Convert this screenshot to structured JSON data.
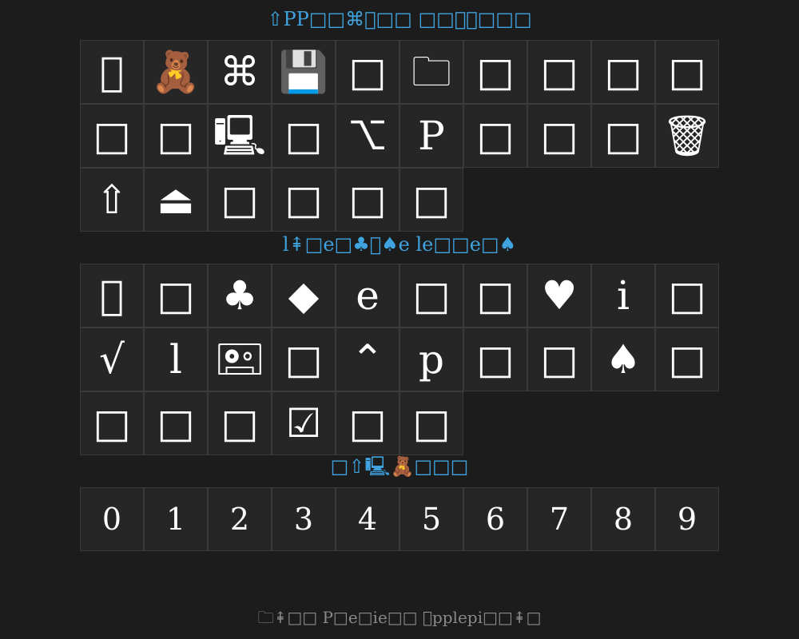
{
  "section1": {
    "heading": "⇧PP□□⌘□□ □□🗑🗑□□□",
    "glyphs": [
      "",
      "🧸",
      "⌘",
      "💾",
      "□",
      "🗀",
      "□",
      "□",
      "□",
      "□",
      "□",
      "□",
      "🖳",
      "□",
      "⌥",
      "P",
      "□",
      "□",
      "□",
      "🗑",
      "⇧",
      "⏏",
      "□",
      "□",
      "□",
      "□"
    ]
  },
  "section2": {
    "heading": "l⇞□e□♣♠e le□□e□♠",
    "glyphs": [
      "",
      "□",
      "♣",
      "◆",
      "e",
      "□",
      "□",
      "♥",
      "i",
      "□",
      "√",
      "l",
      "🖭",
      "□",
      "⌃",
      "p",
      "□",
      "□",
      "♠",
      "□",
      "□",
      "□",
      "□",
      "☑",
      "□",
      "□"
    ]
  },
  "section3": {
    "heading": "□⇧🖳🧸□□□",
    "digits": [
      "0",
      "1",
      "2",
      "3",
      "4",
      "5",
      "6",
      "7",
      "8",
      "9"
    ]
  },
  "footer": "🗀⇞□□ P□e□ie□□ pplepi□□⇞□"
}
